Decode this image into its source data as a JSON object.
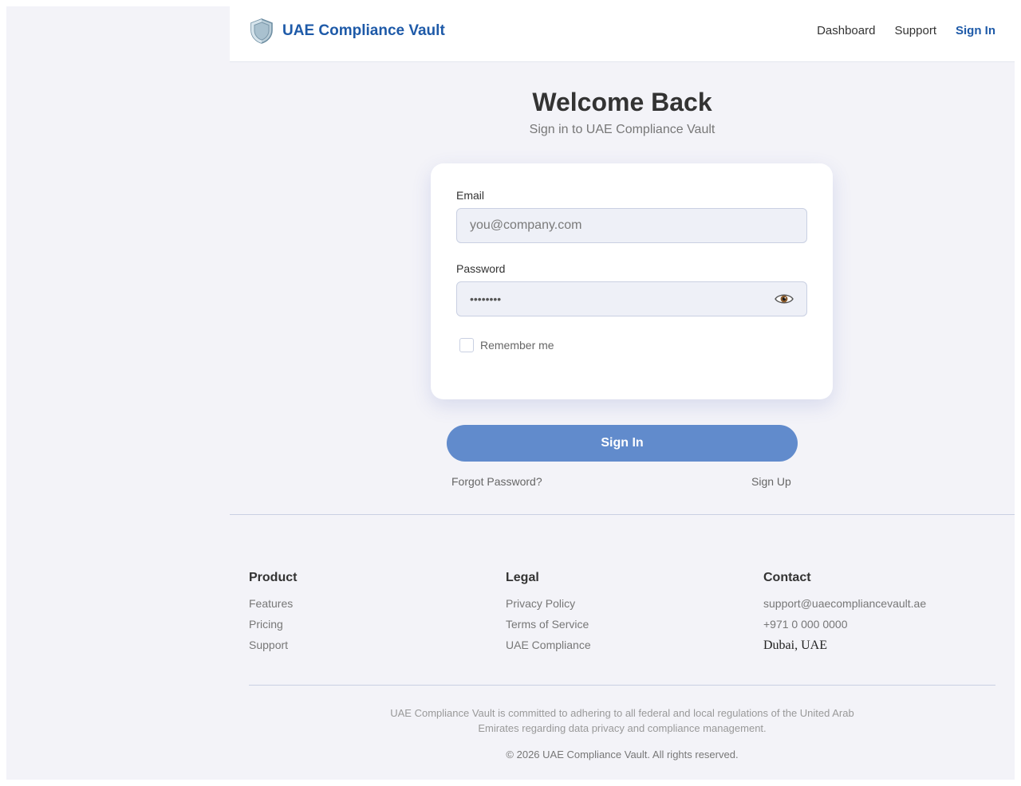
{
  "header": {
    "brand_title": "UAE Compliance Vault",
    "nav": [
      {
        "label": "Dashboard"
      },
      {
        "label": "Support"
      },
      {
        "label": "Sign In"
      }
    ]
  },
  "hero": {
    "title": "Welcome Back",
    "subtitle": "Sign in to UAE Compliance Vault"
  },
  "form": {
    "email_label": "Email",
    "email_placeholder": "you@company.com",
    "password_label": "Password",
    "password_masked": "••••••••",
    "remember_label": "Remember me",
    "sign_in_label": "Sign In",
    "forgot_label": "Forgot Password?",
    "sign_up_label": "Sign Up"
  },
  "footer": {
    "columns": [
      {
        "title": "Product",
        "items": [
          "Features",
          "Pricing",
          "Support"
        ]
      },
      {
        "title": "Legal",
        "items": [
          "Privacy Policy",
          "Terms of Service",
          "UAE Compliance"
        ]
      },
      {
        "title": "Contact",
        "items": [
          "support@uaecompliancevault.ae",
          "+971 0 000 0000",
          "Dubai, UAE"
        ]
      }
    ],
    "statement": "UAE Compliance Vault is committed to adhering to all federal and local regulations of the United Arab Emirates regarding data privacy and compliance management.",
    "copyright": "© 2026 UAE Compliance Vault. All rights reserved."
  },
  "icons": {
    "brand": "shield-icon",
    "password_toggle": "eye-icon"
  },
  "colors": {
    "brand": "#1e5aa8",
    "button": "#618bcc",
    "background": "#f3f3f8"
  }
}
